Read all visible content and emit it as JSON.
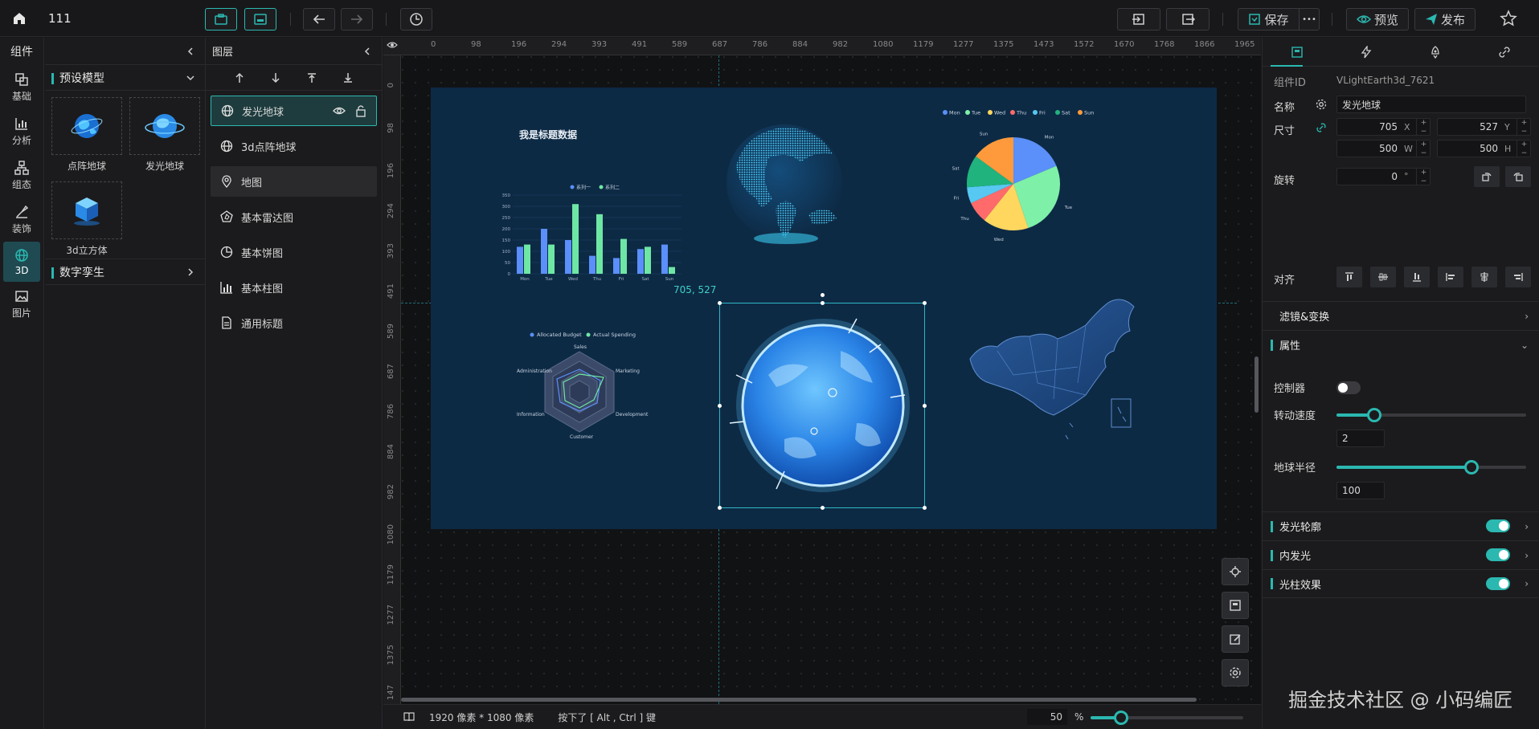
{
  "topbar": {
    "project_name": "111",
    "save_label": "保存",
    "more_label": "•••",
    "preview_label": "预览",
    "publish_label": "发布"
  },
  "rail": {
    "title": "组件",
    "items": [
      {
        "label": "基础",
        "icon": "layers-icon"
      },
      {
        "label": "分析",
        "icon": "bar-chart-icon"
      },
      {
        "label": "组态",
        "icon": "topology-icon"
      },
      {
        "label": "装饰",
        "icon": "brush-icon"
      },
      {
        "label": "3D",
        "icon": "globe-icon"
      },
      {
        "label": "图片",
        "icon": "image-icon"
      }
    ]
  },
  "components_panel": {
    "group1": "预设模型",
    "models": [
      {
        "label": "点阵地球"
      },
      {
        "label": "发光地球"
      },
      {
        "label": "3d立方体"
      }
    ],
    "group2": "数字孪生"
  },
  "layers": {
    "title": "图层",
    "items": [
      {
        "label": "发光地球",
        "icon": "globe-icon"
      },
      {
        "label": "3d点阵地球",
        "icon": "globe-icon"
      },
      {
        "label": "地图",
        "icon": "map-pin-icon"
      },
      {
        "label": "基本雷达图",
        "icon": "radar-icon"
      },
      {
        "label": "基本饼图",
        "icon": "pie-icon"
      },
      {
        "label": "基本柱图",
        "icon": "bar-chart-icon"
      },
      {
        "label": "通用标题",
        "icon": "document-icon"
      }
    ]
  },
  "rulers": {
    "top": [
      "0",
      "98",
      "196",
      "294",
      "393",
      "491",
      "589",
      "687",
      "786",
      "884",
      "982",
      "1080",
      "1179",
      "1277",
      "1375",
      "1473",
      "1572",
      "1670",
      "1768",
      "1866",
      "1965"
    ],
    "left": [
      "0",
      "98",
      "196",
      "294",
      "393",
      "491",
      "589",
      "687",
      "786",
      "884",
      "982",
      "1080",
      "1179",
      "1277",
      "1375",
      "147"
    ]
  },
  "canvas": {
    "title_widget_text": "我是标题数据",
    "cursor_coords": "705, 527",
    "bar_chart": {
      "legend": [
        "系列一",
        "系列二"
      ],
      "categories": [
        "Mon",
        "Tue",
        "Wed",
        "Thu",
        "Fri",
        "Sat",
        "Sun"
      ],
      "y_ticks": [
        "350",
        "300",
        "250",
        "200",
        "150",
        "100",
        "50",
        "0"
      ],
      "series": [
        {
          "values": [
            120,
            200,
            150,
            80,
            70,
            110,
            130
          ],
          "color": "#5b8ff9"
        },
        {
          "values": [
            130,
            130,
            310,
            265,
            155,
            120,
            30
          ],
          "color": "#6ee7a5"
        }
      ]
    },
    "pie_chart": {
      "legend": [
        "Mon",
        "Tue",
        "Wed",
        "Thu",
        "Fri",
        "Sat",
        "Sun"
      ],
      "colors": [
        "#5b8ff9",
        "#7ef0a8",
        "#ffd75e",
        "#ff6b6b",
        "#56c8f2",
        "#20b37e",
        "#ff9a3c"
      ],
      "values": [
        20,
        28,
        17,
        8,
        6,
        12,
        16
      ]
    },
    "radar_chart": {
      "legend": [
        "Allocated Budget",
        "Actual Spending"
      ],
      "indicators": [
        "Sales",
        "Marketing",
        "Development",
        "Customer",
        "Information",
        "Administration"
      ]
    }
  },
  "statusbar": {
    "resolution": "1920 像素 * 1080 像素",
    "hint": "按下了 [ Alt , Ctrl ] 键",
    "zoom_value": "50",
    "zoom_unit": "%",
    "zoom_fraction": 0.2
  },
  "props": {
    "id_label": "组件ID",
    "id_value": "VLightEarth3d_7621",
    "name_label": "名称",
    "name_value": "发光地球",
    "size_label": "尺寸",
    "x_value": "705",
    "x_unit": "X",
    "y_value": "527",
    "y_unit": "Y",
    "w_value": "500",
    "w_unit": "W",
    "h_value": "500",
    "h_unit": "H",
    "rotate_label": "旋转",
    "rotate_value": "0",
    "rotate_unit": "°",
    "align_label": "对齐",
    "filter_section": "滤镜&变换",
    "attr_section": "属性",
    "controller_label": "控制器",
    "controller_on": false,
    "speed_label": "转动速度",
    "speed_value": "2",
    "speed_fraction": 0.2,
    "radius_label": "地球半径",
    "radius_value": "100",
    "radius_fraction": 0.71,
    "glow_outline_label": "发光轮廓",
    "inner_glow_label": "内发光",
    "light_pillar_label": "光柱效果"
  },
  "watermark": "掘金技术社区 @ 小码编匠"
}
